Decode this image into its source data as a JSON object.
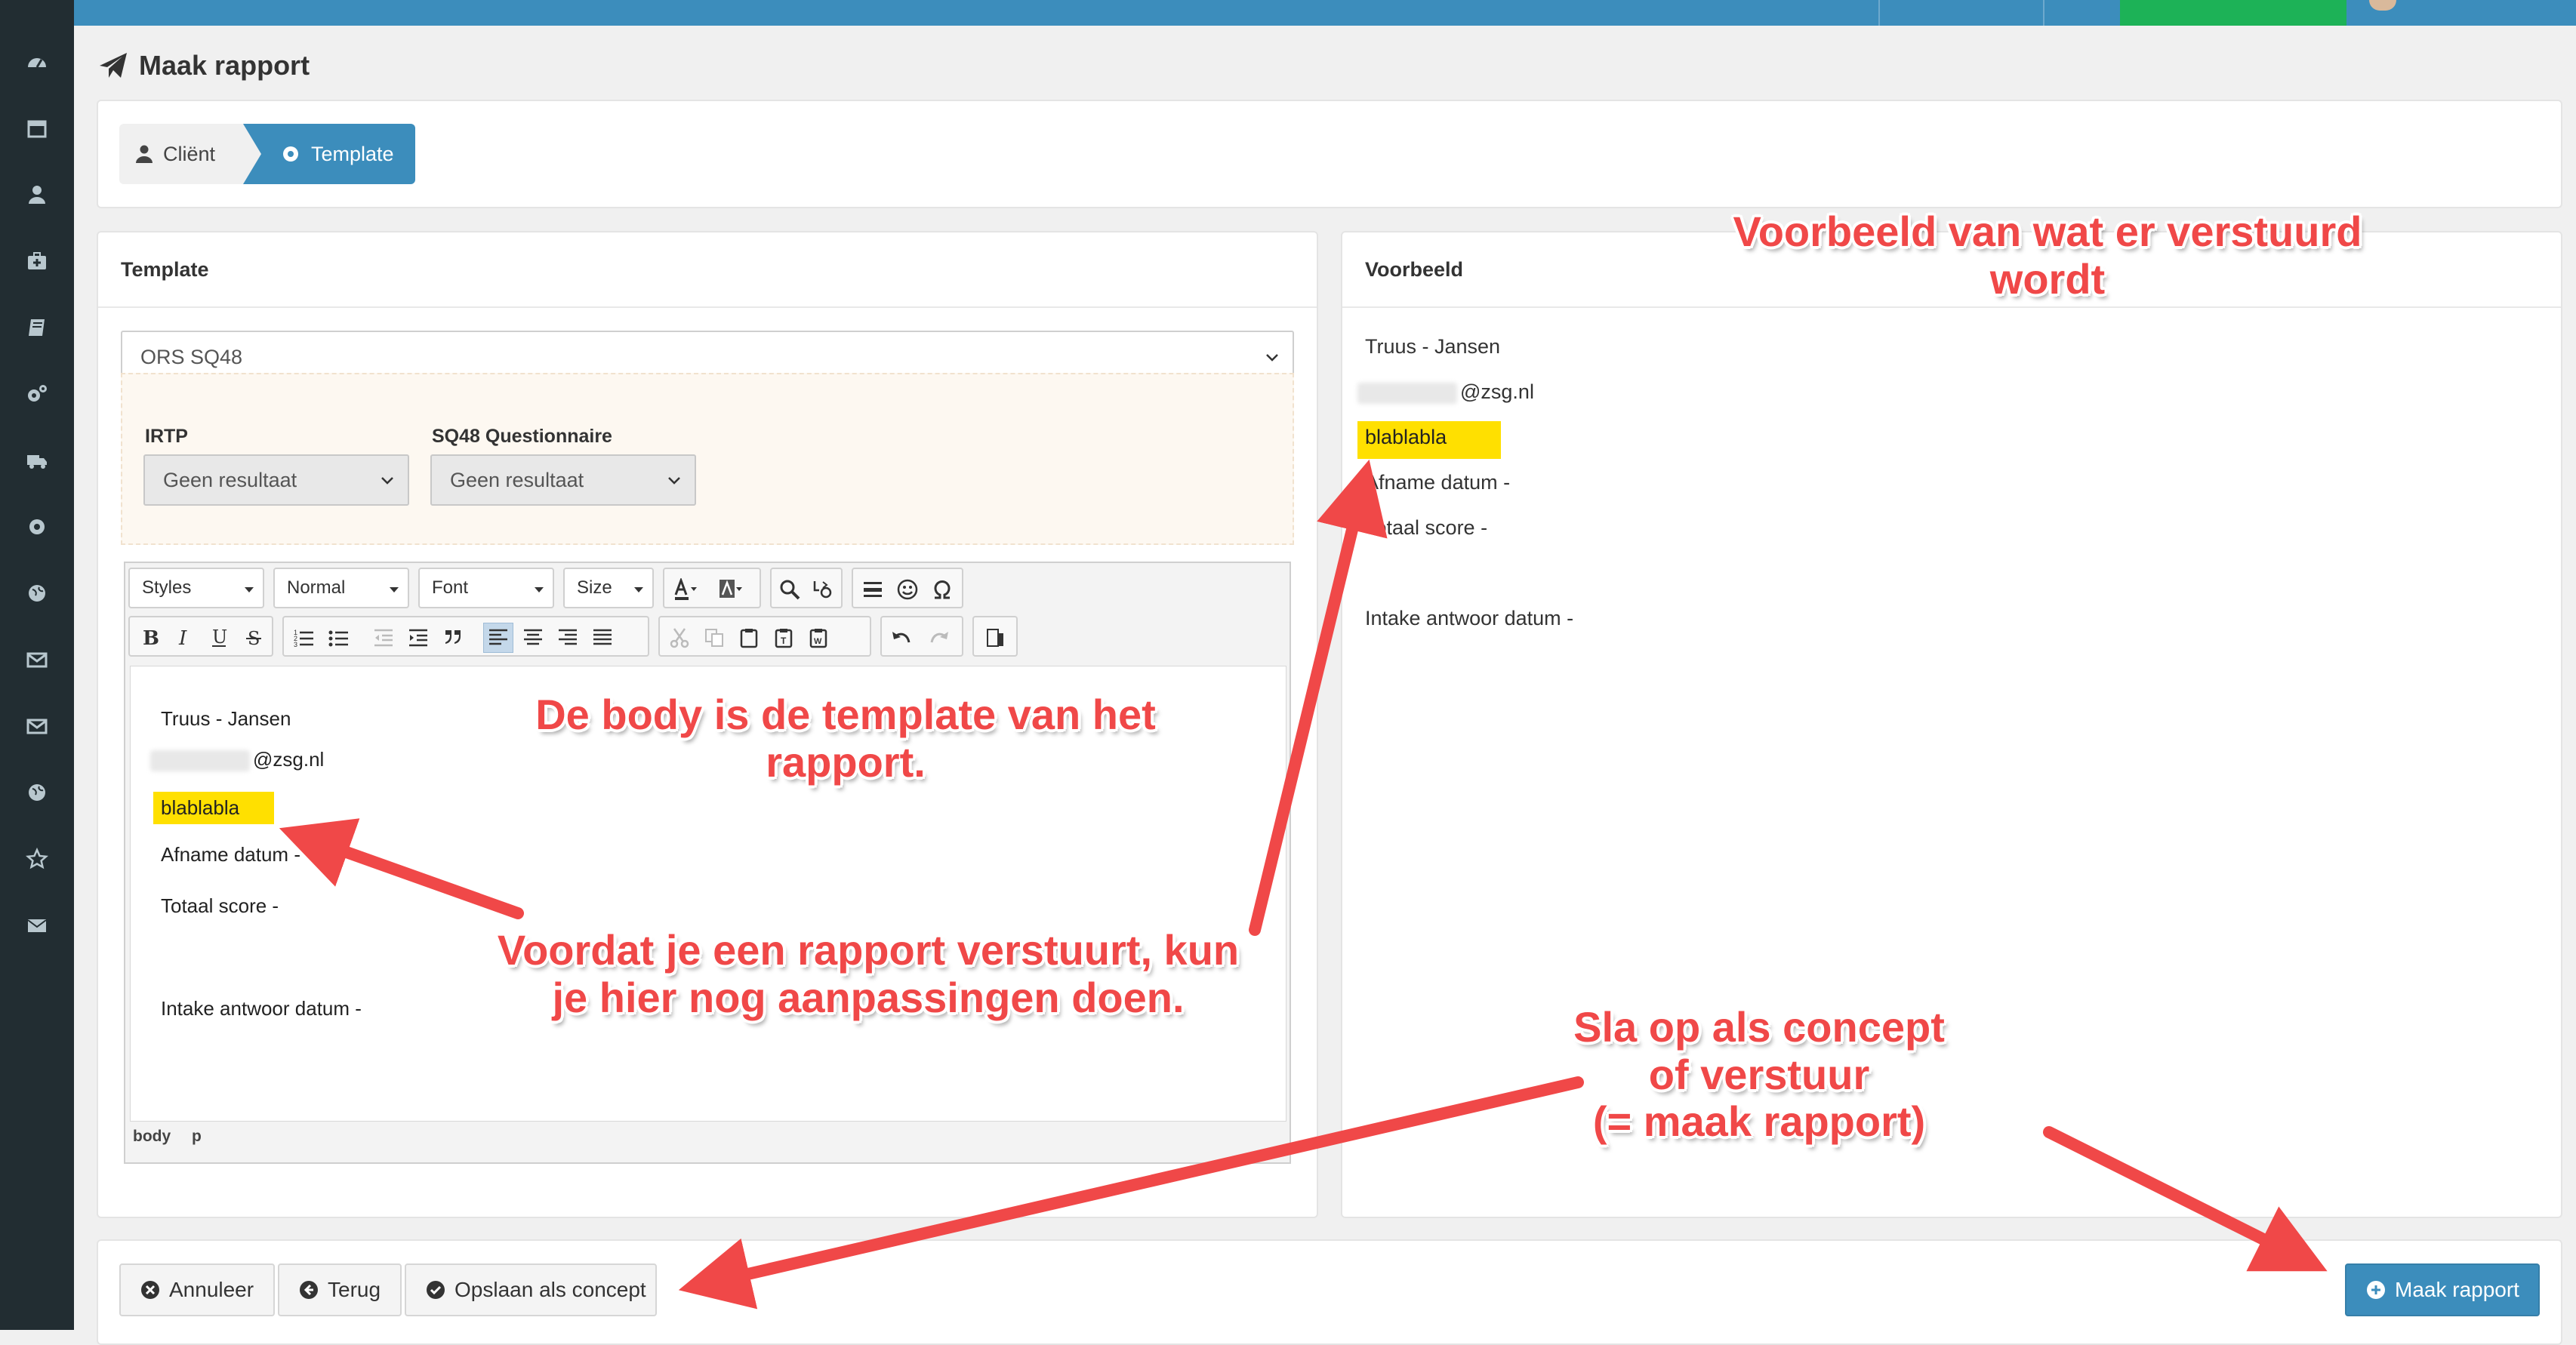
{
  "page": {
    "title": "Maak rapport"
  },
  "wizard": {
    "step1": "Cliënt",
    "step2": "Template"
  },
  "template_panel": {
    "heading": "Template",
    "template_select": "ORS SQ48",
    "irtp_label": "IRTP",
    "irtp_value": "Geen resultaat",
    "sq48_label": "SQ48 Questionnaire",
    "sq48_value": "Geen resultaat"
  },
  "toolbar": {
    "styles": "Styles",
    "format": "Normal",
    "font": "Font",
    "size": "Size"
  },
  "editor": {
    "line1": "Truus - Jansen",
    "email": "@zsg.nl",
    "highlight": "blablabla",
    "afname": "Afname datum -",
    "totaal": "Totaal score -",
    "intake": "Intake antwoor datum -",
    "path_body": "body",
    "path_p": "p"
  },
  "preview_panel": {
    "heading": "Voorbeeld",
    "line1": "Truus - Jansen",
    "email": "@zsg.nl",
    "highlight": "blablabla",
    "afname": "Afname datum -",
    "totaal": "Totaal score -",
    "intake": "Intake antwoor datum -"
  },
  "footer": {
    "cancel": "Annuleer",
    "back": "Terug",
    "save_concept": "Opslaan als concept",
    "make_report": "Maak rapport"
  },
  "annotations": {
    "preview_note": "Voorbeeld van wat er verstuurd wordt",
    "body_note": "De body is de template van het rapport.",
    "edit_note": "Voordat je een rapport verstuurt, kun\nje hier nog aanpassingen doen.",
    "save_note": "Sla op als concept\nof verstuur\n(= maak rapport)"
  },
  "colors": {
    "primary": "#3c8dbc",
    "sidebar": "#222d32",
    "highlight": "#ffe000",
    "annotation": "#f04848",
    "green": "#1db257"
  }
}
